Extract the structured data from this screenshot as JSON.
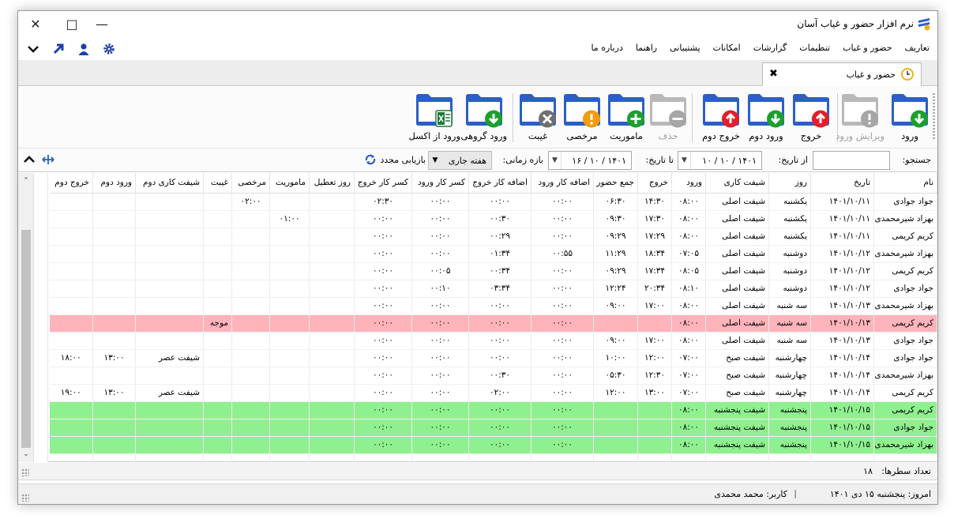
{
  "window": {
    "title": "نرم افزار حضور و غیاب آسان"
  },
  "menu": [
    "تعاریف",
    "حضور و غیاب",
    "تنظیمات",
    "گزارشات",
    "امکانات",
    "پشتیبانی",
    "راهنما",
    "درباره ما"
  ],
  "tab": {
    "label": "حضور و غیاب"
  },
  "toolbar": {
    "enter": "ورود",
    "edit_enter": "ویرایش ورود",
    "exit": "خروج",
    "enter2": "ورود دوم",
    "exit2": "خروج دوم",
    "delete": "حذف",
    "mission": "ماموریت",
    "leave": "مرخصی",
    "absent": "غیبت",
    "group_enter": "ورود گروهی",
    "excel_enter": "ورود از اکسل"
  },
  "filters": {
    "search_label": "جستجو:",
    "search_value": "",
    "from_label": "از تاریخ:",
    "from_value": "۱۴۰۱ / ۱۰ / ۱۰",
    "to_label": "تا تاریخ:",
    "to_value": "۱۴۰۱ / ۱۰ / ۱۶",
    "range_label": "بازه زمانی:",
    "range_value": "هفته جاری",
    "reload_label": "بازیابی مجدد"
  },
  "table": {
    "columns": [
      "نام",
      "تاریخ",
      "روز",
      "شیفت کاری",
      "ورود",
      "خروج",
      "جمع حضور",
      "اضافه کار ورود",
      "اضافه کار خروج",
      "کسر کار ورود",
      "کسر کار خروج",
      "روز تعطیل",
      "ماموریت",
      "مرخصی",
      "غیبت",
      "شیفت کاری دوم",
      "ورود دوم",
      "خروج دوم"
    ],
    "rows": [
      {
        "style": "",
        "cells": [
          "جواد جوادی",
          "۱۴۰۱/۱۰/۱۱",
          "یکشنبه",
          "شیفت اصلی",
          "۰۸:۰۰",
          "۱۴:۳۰",
          "۰۶:۳۰",
          "۰۰:۰۰",
          "۰۰:۰۰",
          "۰۰:۰۰",
          "۰۲:۳۰",
          "",
          "",
          "۰۲:۰۰",
          "",
          "",
          "",
          ""
        ]
      },
      {
        "style": "",
        "cells": [
          "بهزاد شیرمحمدی",
          "۱۴۰۱/۱۰/۱۱",
          "یکشنبه",
          "شیفت اصلی",
          "۰۸:۰۰",
          "۱۷:۳۰",
          "۰۹:۳۰",
          "۰۰:۰۰",
          "۰۰:۳۰",
          "۰۰:۰۰",
          "۰۰:۰۰",
          "",
          "۰۱:۰۰",
          "",
          "",
          "",
          "",
          ""
        ]
      },
      {
        "style": "",
        "cells": [
          "کریم کریمی",
          "۱۴۰۱/۱۰/۱۱",
          "یکشنبه",
          "شیفت اصلی",
          "۰۸:۰۰",
          "۱۷:۲۹",
          "۰۹:۲۹",
          "۰۰:۰۰",
          "۰۰:۲۹",
          "۰۰:۰۰",
          "۰۰:۰۰",
          "",
          "",
          "",
          "",
          "",
          "",
          ""
        ]
      },
      {
        "style": "",
        "cells": [
          "بهزاد شیرمحمدی",
          "۱۴۰۱/۱۰/۱۲",
          "دوشنبه",
          "شیفت اصلی",
          "۰۷:۰۵",
          "۱۸:۳۴",
          "۱۱:۲۹",
          "۰۰:۵۵",
          "۰۱:۳۴",
          "۰۰:۰۰",
          "۰۰:۰۰",
          "",
          "",
          "",
          "",
          "",
          "",
          ""
        ]
      },
      {
        "style": "",
        "cells": [
          "کریم کریمی",
          "۱۴۰۱/۱۰/۱۲",
          "دوشنبه",
          "شیفت اصلی",
          "۰۸:۰۵",
          "۱۷:۳۴",
          "۰۹:۲۹",
          "۰۰:۰۰",
          "۰۰:۳۴",
          "۰۰:۰۵",
          "۰۰:۰۰",
          "",
          "",
          "",
          "",
          "",
          "",
          ""
        ]
      },
      {
        "style": "",
        "cells": [
          "جواد جوادی",
          "۱۴۰۱/۱۰/۱۲",
          "دوشنبه",
          "شیفت اصلی",
          "۰۸:۱۰",
          "۲۰:۳۴",
          "۱۲:۲۴",
          "۰۰:۰۰",
          "۰۳:۳۴",
          "۰۰:۱۰",
          "۰۰:۰۰",
          "",
          "",
          "",
          "",
          "",
          "",
          ""
        ]
      },
      {
        "style": "",
        "cells": [
          "بهزاد شیرمحمدی",
          "۱۴۰۱/۱۰/۱۳",
          "سه شنبه",
          "شیفت اصلی",
          "۰۸:۰۰",
          "۱۷:۰۰",
          "۰۹:۰۰",
          "۰۰:۰۰",
          "۰۰:۰۰",
          "۰۰:۰۰",
          "۰۰:۰۰",
          "",
          "",
          "",
          "",
          "",
          "",
          ""
        ]
      },
      {
        "style": "pink",
        "cells": [
          "کریم کریمی",
          "۱۴۰۱/۱۰/۱۳",
          "سه شنبه",
          "شیفت اصلی",
          "۰۸:۰۰",
          "",
          "",
          "۰۰:۰۰",
          "۰۰:۰۰",
          "۰۰:۰۰",
          "۰۰:۰۰",
          "",
          "",
          "",
          "موجه",
          "",
          "",
          ""
        ]
      },
      {
        "style": "",
        "cells": [
          "جواد جوادی",
          "۱۴۰۱/۱۰/۱۳",
          "سه شنبه",
          "شیفت اصلی",
          "۰۸:۰۰",
          "۱۷:۰۰",
          "۰۹:۰۰",
          "۰۰:۰۰",
          "۰۰:۰۰",
          "۰۰:۰۰",
          "۰۰:۰۰",
          "",
          "",
          "",
          "",
          "",
          "",
          ""
        ]
      },
      {
        "style": "",
        "cells": [
          "جواد جوادی",
          "۱۴۰۱/۱۰/۱۴",
          "چهارشنبه",
          "شیفت صبح",
          "۰۷:۰۰",
          "۱۲:۰۰",
          "۱۰:۰۰",
          "۰۰:۰۰",
          "۰۰:۰۰",
          "۰۰:۰۰",
          "۰۰:۰۰",
          "",
          "",
          "",
          "",
          "شیفت عصر",
          "۱۳:۰۰",
          "۱۸:۰۰"
        ]
      },
      {
        "style": "",
        "cells": [
          "بهزاد شیرمحمدی",
          "۱۴۰۱/۱۰/۱۴",
          "چهارشنبه",
          "شیفت صبح",
          "۰۷:۰۰",
          "۱۲:۳۰",
          "۰۵:۳۰",
          "۰۰:۰۰",
          "۰۰:۳۰",
          "۰۰:۰۰",
          "۰۰:۰۰",
          "",
          "",
          "",
          "",
          "",
          "",
          ""
        ]
      },
      {
        "style": "",
        "cells": [
          "کریم کریمی",
          "۱۴۰۱/۱۰/۱۴",
          "چهارشنبه",
          "شیفت صبح",
          "۰۷:۰۰",
          "۱۳:۰۰",
          "۱۲:۰۰",
          "۰۰:۰۰",
          "۰۲:۰۰",
          "۰۰:۰۰",
          "۰۰:۰۰",
          "",
          "",
          "",
          "",
          "شیفت عصر",
          "۱۳:۰۰",
          "۱۹:۰۰"
        ]
      },
      {
        "style": "green",
        "cells": [
          "کریم کریمی",
          "۱۴۰۱/۱۰/۱۵",
          "پنجشنبه",
          "شیفت پنجشنبه",
          "۰۸:۰۰",
          "",
          "",
          "۰۰:۰۰",
          "۰۰:۰۰",
          "۰۰:۰۰",
          "۰۰:۰۰",
          "",
          "",
          "",
          "",
          "",
          "",
          ""
        ]
      },
      {
        "style": "green",
        "cells": [
          "جواد جوادی",
          "۱۴۰۱/۱۰/۱۵",
          "پنجشنبه",
          "شیفت پنجشنبه",
          "۰۸:۰۰",
          "",
          "",
          "۰۰:۰۰",
          "۰۰:۰۰",
          "۰۰:۰۰",
          "۰۰:۰۰",
          "",
          "",
          "",
          "",
          "",
          "",
          ""
        ]
      },
      {
        "style": "green",
        "cells": [
          "بهزاد شیرمحمدی",
          "۱۴۰۱/۱۰/۱۵",
          "پنجشنبه",
          "شیفت پنجشنبه",
          "۰۸:۰۰",
          "",
          "",
          "۰۰:۰۰",
          "۰۰:۰۰",
          "۰۰:۰۰",
          "۰۰:۰۰",
          "",
          "",
          "",
          "",
          "",
          "",
          ""
        ]
      }
    ]
  },
  "footer": {
    "row_count_label": "تعداد سطرها:",
    "row_count": "۱۸",
    "today": "امروز: پنجشنبه ۱۵ دی ۱۴۰۱",
    "separator": "|",
    "user": "کاربر: محمد محمدی"
  },
  "colors": {
    "folder": "#2b5fc7",
    "green": "#1e9e2e",
    "red": "#e21f2a",
    "orange": "#f29b0c",
    "gray": "#a9a9a9",
    "pink_row": "#ffb3bb",
    "green_row": "#8ff08f"
  },
  "icons": [
    "settings-icon",
    "user-icon",
    "arrow-up-right-icon",
    "chevron-down-icon",
    "clock-icon",
    "close-icon",
    "search-reload-icon",
    "expand-icon",
    "collapse-up-icon"
  ]
}
